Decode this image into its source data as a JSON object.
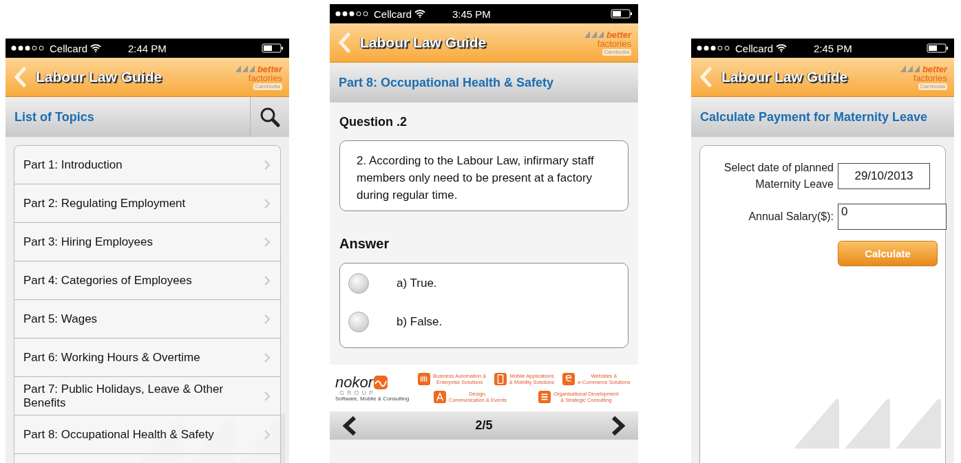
{
  "phones": [
    {
      "kind": "topics",
      "status": {
        "carrier": "Cellcard",
        "time": "2:44 PM"
      },
      "nav": {
        "title": "Labour Law Guide",
        "logo": {
          "word1": "better",
          "word2": "factories",
          "region": "Cambodia"
        }
      },
      "header": {
        "title": "List of Topics"
      },
      "topics": [
        {
          "label": "Part 1: Introduction"
        },
        {
          "label": "Part 2: Regulating Employment"
        },
        {
          "label": "Part 3: Hiring Employees"
        },
        {
          "label": "Part 4: Categories of Employees"
        },
        {
          "label": "Part 5: Wages"
        },
        {
          "label": "Part 6: Working Hours & Overtime"
        },
        {
          "label": "Part 7: Public Holidays, Leave & Other Benefits"
        },
        {
          "label": "Part 8: Occupational Health & Safety"
        }
      ]
    },
    {
      "kind": "quiz",
      "status": {
        "carrier": "Cellcard",
        "time": "3:45 PM"
      },
      "nav": {
        "title": "Labour Law Guide",
        "logo": {
          "word1": "better",
          "word2": "factories",
          "region": "Cambodia"
        }
      },
      "header": {
        "title": "Part 8: Occupational Health & Safety"
      },
      "question_label": "Question .2",
      "question": "2. According to the Labour Law, infirmary staff members only need to be present at a factory during regular time.",
      "answer_label": "Answer",
      "options": [
        {
          "label": "a) True.",
          "selected": false
        },
        {
          "label": "b) False.",
          "selected": false
        }
      ],
      "sponsor": {
        "name": "nokor",
        "group": "GROUP",
        "tagline": "Software, Mobile & Consulting",
        "services": [
          {
            "text": "Business Automation &\nEnterprise Solutions",
            "kind": "people"
          },
          {
            "text": "Mobile Applications\n& Mobility Solutions",
            "kind": "phone"
          },
          {
            "text": "Websites &\ne-Commerce Solutions",
            "kind": "ecommerce"
          },
          {
            "text": "Design,\nCommunication & Events",
            "kind": "design"
          },
          {
            "text": "Organisational Development\n& Strategic Consulting",
            "kind": "stack"
          }
        ]
      },
      "pager": "2/5"
    },
    {
      "kind": "maternity",
      "status": {
        "carrier": "Cellcard",
        "time": "2:45 PM"
      },
      "nav": {
        "title": "Labour Law Guide",
        "logo": {
          "word1": "better",
          "word2": "factories",
          "region": "Cambodia"
        }
      },
      "header": {
        "title": "Calculate Payment for Maternity Leave"
      },
      "fields": [
        {
          "label": "Select date of planned\nMaternity Leave",
          "value": "29/10/2013",
          "kind": "date"
        },
        {
          "label": "Annual Salary($):",
          "value": "0",
          "kind": "text"
        }
      ],
      "button": "Calculate"
    }
  ]
}
